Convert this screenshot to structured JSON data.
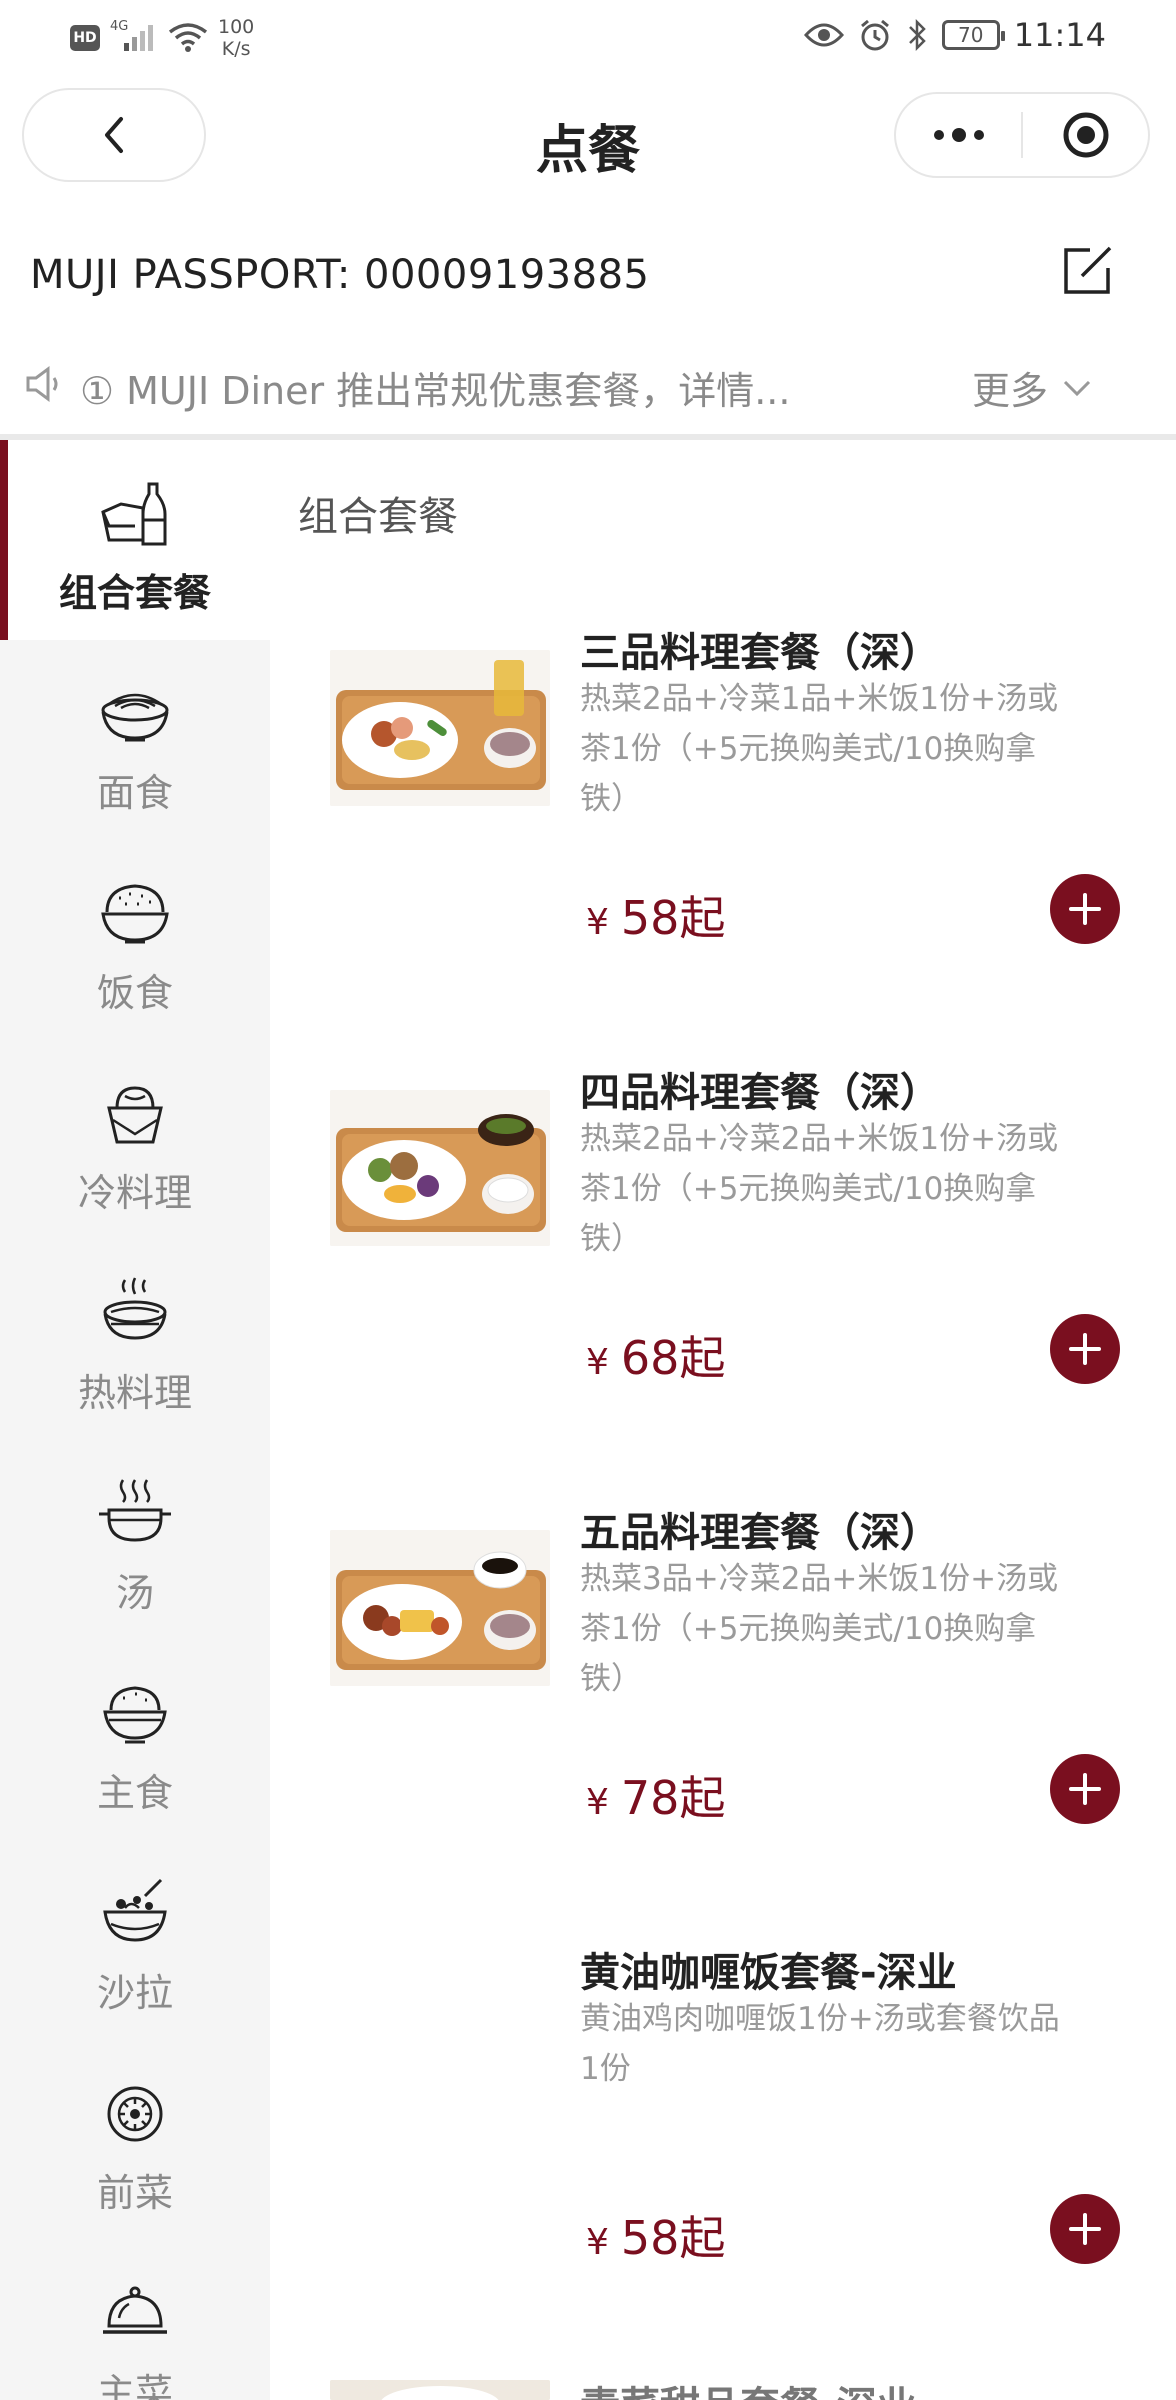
{
  "status_bar": {
    "hd": "HD",
    "network": "4G",
    "speed_value": "100",
    "speed_unit": "K/s",
    "battery": "70",
    "time": "11:14"
  },
  "nav": {
    "title": "点餐",
    "back_icon": "chevron-left-icon",
    "more_icon": "more-dots-icon",
    "close_icon": "target-circle-icon"
  },
  "passport": {
    "text": "MUJI PASSPORT: 00009193885",
    "edit_icon": "edit-icon"
  },
  "notice": {
    "text": "① MUJI Diner 推出常规优惠套餐，详情...",
    "more_label": "更多",
    "icon": "speaker-icon"
  },
  "sidebar": {
    "items": [
      {
        "label": "组合套餐",
        "icon": "combo-meal-icon",
        "active": true
      },
      {
        "label": "面食",
        "icon": "noodle-bowl-icon",
        "active": false
      },
      {
        "label": "饭食",
        "icon": "rice-bowl-icon",
        "active": false
      },
      {
        "label": "冷料理",
        "icon": "cold-dish-icon",
        "active": false
      },
      {
        "label": "热料理",
        "icon": "hot-dish-icon",
        "active": false
      },
      {
        "label": "汤",
        "icon": "soup-pot-icon",
        "active": false
      },
      {
        "label": "主食",
        "icon": "staple-bowl-icon",
        "active": false
      },
      {
        "label": "沙拉",
        "icon": "salad-bowl-icon",
        "active": false
      },
      {
        "label": "前菜",
        "icon": "appetizer-plate-icon",
        "active": false
      },
      {
        "label": "主菜",
        "icon": "cloche-icon",
        "active": false
      }
    ]
  },
  "main": {
    "section_title": "组合套餐",
    "currency": "¥",
    "items": [
      {
        "name": "三品料理套餐（深）",
        "desc": "热菜2品+冷菜1品+米饭1份+汤或茶1份（+5元换购美式/10换购拿铁）",
        "price": "58起",
        "has_photo": true
      },
      {
        "name": "四品料理套餐（深）",
        "desc": "热菜2品+冷菜2品+米饭1份+汤或茶1份（+5元换购美式/10换购拿铁）",
        "price": "68起",
        "has_photo": true
      },
      {
        "name": "五品料理套餐（深）",
        "desc": "热菜3品+冷菜2品+米饭1份+汤或茶1份（+5元换购美式/10换购拿铁）",
        "price": "78起",
        "has_photo": true
      },
      {
        "name": "黄油咖喱饭套餐-深业",
        "desc": "黄油鸡肉咖喱饭1份+汤或套餐饮品1份",
        "price": "58起",
        "has_photo": false
      },
      {
        "name": "素菜甜品套餐-深业",
        "desc": "",
        "price": "",
        "has_photo": true
      }
    ]
  },
  "colors": {
    "accent": "#7a0f1f",
    "sidebar_bg": "#f5f5f5",
    "muted_text": "#9a9a9a"
  }
}
